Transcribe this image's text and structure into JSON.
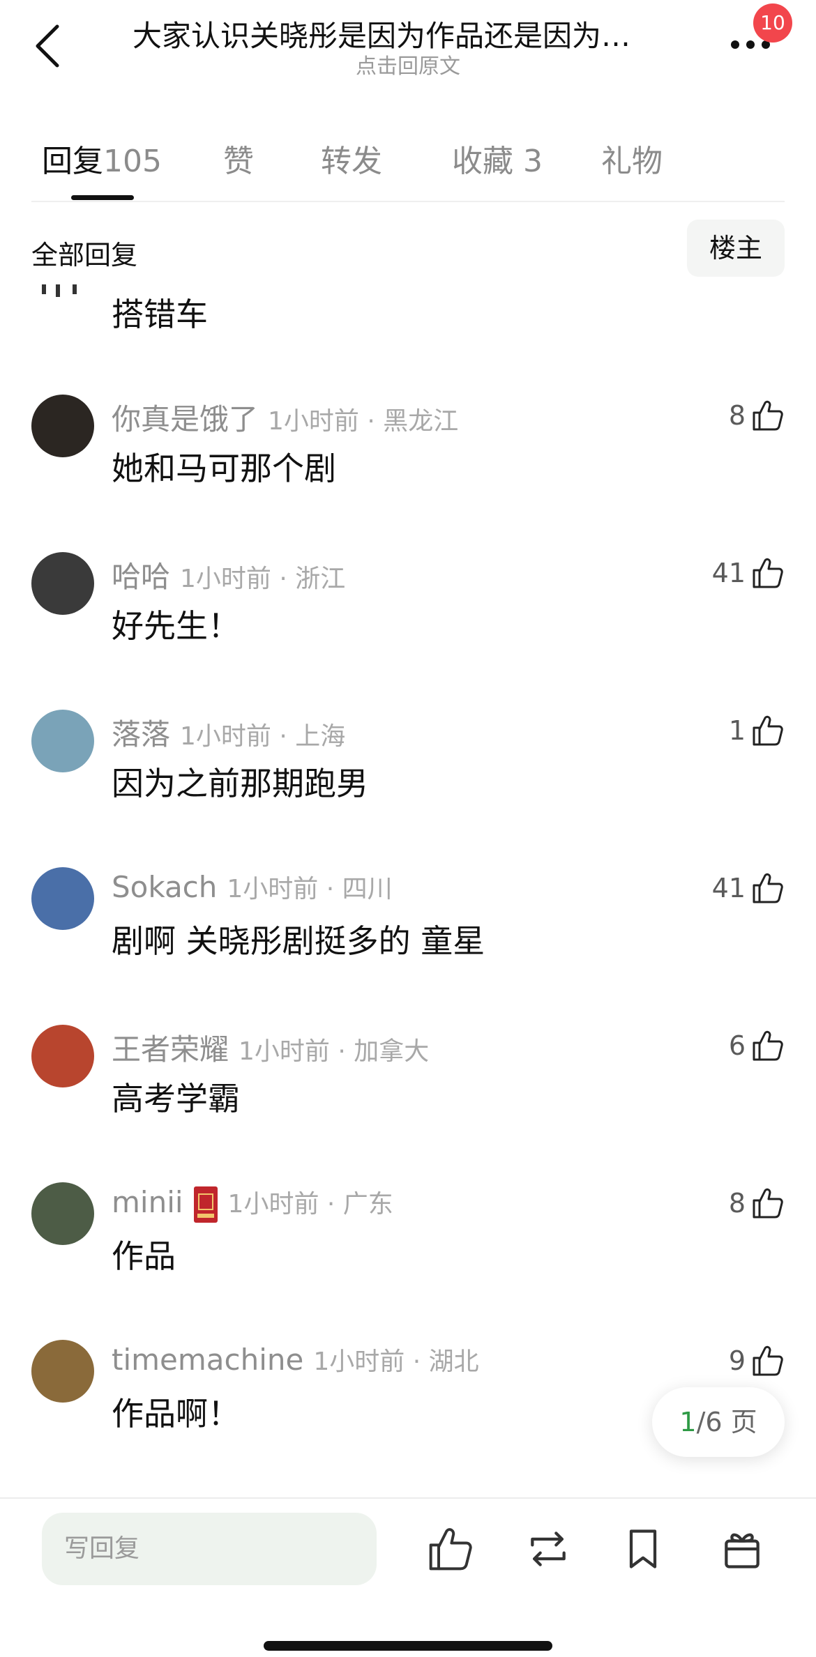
{
  "header": {
    "title": "大家认识关晓彤是因为作品还是因为…",
    "subtitle": "点击回原文",
    "badge_count": "10"
  },
  "tabs": [
    {
      "label": "回复",
      "count": "105",
      "active": true
    },
    {
      "label": "赞",
      "count": ""
    },
    {
      "label": "转发",
      "count": ""
    },
    {
      "label": "收藏",
      "count": "3"
    },
    {
      "label": "礼物",
      "count": ""
    }
  ],
  "section": {
    "title": "全部回复",
    "owner_button": "楼主"
  },
  "partial_comment": {
    "text": "搭错车"
  },
  "comments": [
    {
      "user": "你真是饿了",
      "time": "1小时前 · 黑龙江",
      "text": "她和马可那个剧",
      "likes": "8",
      "avatar_color": "#2b2622"
    },
    {
      "user": "哈哈",
      "time": "1小时前 · 浙江",
      "text": "好先生！",
      "likes": "41",
      "avatar_color": "#3a3a3a"
    },
    {
      "user": "落落",
      "time": "1小时前 · 上海",
      "text": "因为之前那期跑男",
      "likes": "1",
      "avatar_color": "#7aa3b8"
    },
    {
      "user": "Sokach",
      "time": "1小时前 · 四川",
      "text": "剧啊  关晓彤剧挺多的  童星",
      "likes": "41",
      "avatar_color": "#4a6fa8"
    },
    {
      "user": "王者荣耀",
      "time": "1小时前 · 加拿大",
      "text": "高考学霸",
      "likes": "6",
      "avatar_color": "#b8452e"
    },
    {
      "user": "minii",
      "time": "1小时前 · 广东",
      "text": "作品",
      "likes": "8",
      "avatar_color": "#4d5c46",
      "has_gift": true
    },
    {
      "user": "timemachine",
      "time": "1小时前 · 湖北",
      "text": "作品啊！",
      "likes": "9",
      "avatar_color": "#8a6a3a"
    }
  ],
  "pagination": {
    "current": "1",
    "total_text": "/6 页"
  },
  "bottom_bar": {
    "reply_placeholder": "写回复"
  }
}
